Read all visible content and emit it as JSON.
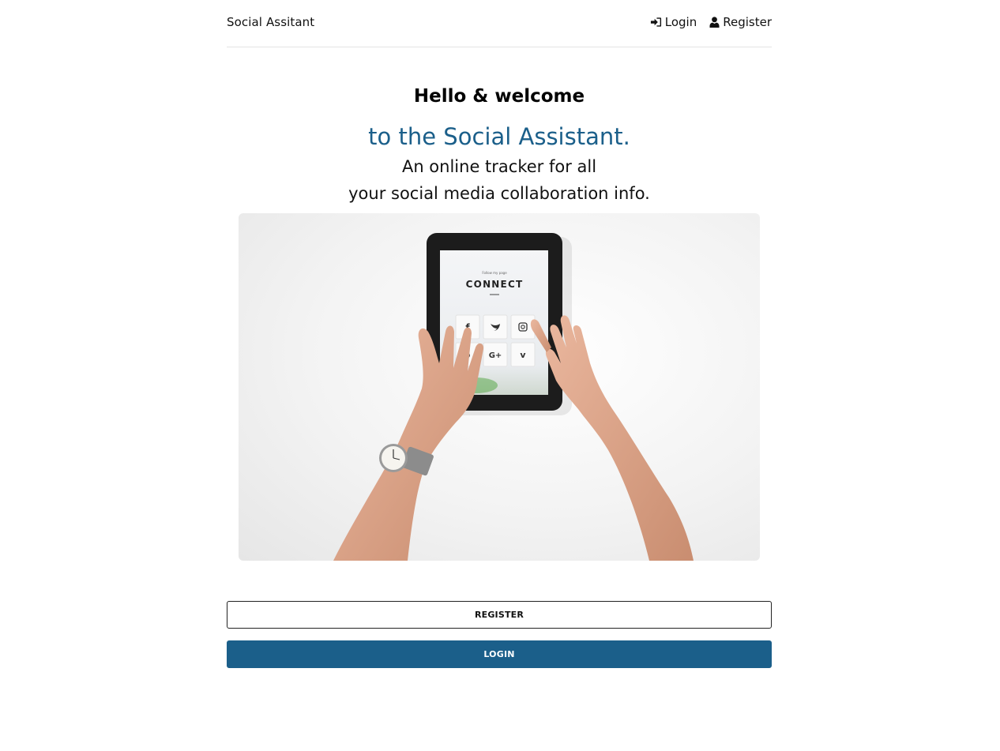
{
  "navbar": {
    "brand": "Social Assitant",
    "login_label": "Login",
    "register_label": "Register"
  },
  "hero": {
    "welcome": "Hello & welcome",
    "assistant": "to the Social Assistant.",
    "tagline_line1": "An online tracker for all",
    "tagline_line2": "your social media collaboration info.",
    "image": {
      "screen_small_text": "Follow my page",
      "screen_title": "CONNECT",
      "icons": [
        "facebook-icon",
        "twitter-icon",
        "instagram-icon",
        "pinterest-icon",
        "google-plus-icon",
        "vine-icon"
      ]
    }
  },
  "actions": {
    "register_button": "REGISTER",
    "login_button": "LOGIN"
  },
  "colors": {
    "accent": "#1b5f8a",
    "border": "#222222",
    "divider": "#e4e4e4"
  }
}
